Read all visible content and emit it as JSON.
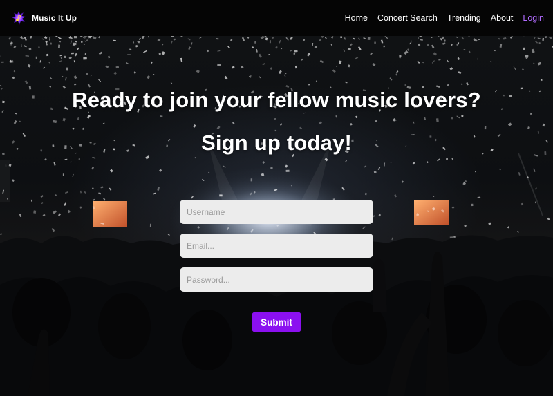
{
  "navbar": {
    "brand": "Music It Up",
    "links": [
      "Home",
      "Concert Search",
      "Trending",
      "About"
    ],
    "login": "Login"
  },
  "hero": {
    "headline": "Ready to join your fellow music lovers?",
    "subheadline": "Sign up today!"
  },
  "form": {
    "username_placeholder": "Username",
    "email_placeholder": "Email...",
    "password_placeholder": "Password...",
    "submit_label": "Submit"
  },
  "colors": {
    "accent": "#8b10f0",
    "login_link": "#b16bff",
    "navbar_bg": "#050505",
    "field_bg": "#ececec"
  },
  "icons": {
    "logo": "music-note-splash-icon"
  }
}
